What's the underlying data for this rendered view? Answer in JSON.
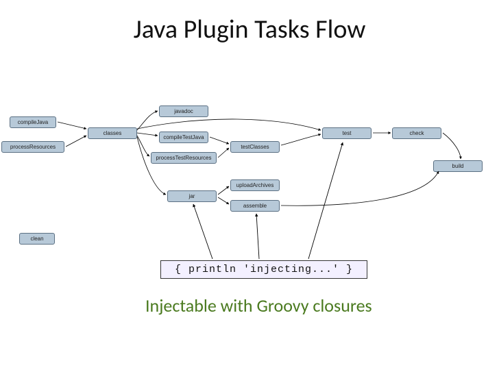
{
  "title": "Java Plugin Tasks Flow",
  "nodes": {
    "compileJava": "compileJava",
    "processResources": "processResources",
    "classes": "classes",
    "javadoc": "javadoc",
    "compileTestJava": "compileTestJava",
    "processTestResources": "processTestResources",
    "testClasses": "testClasses",
    "test": "test",
    "check": "check",
    "build": "build",
    "jar": "jar",
    "uploadArchives": "uploadArchives",
    "assemble": "assemble",
    "clean": "clean"
  },
  "code_snippet": "{ println 'injecting...' }",
  "subtitle": "Injectable with Groovy closures",
  "diagram_edges": [
    [
      "compileJava",
      "classes"
    ],
    [
      "processResources",
      "classes"
    ],
    [
      "classes",
      "javadoc"
    ],
    [
      "classes",
      "compileTestJava"
    ],
    [
      "classes",
      "processTestResources"
    ],
    [
      "classes",
      "jar"
    ],
    [
      "compileTestJava",
      "testClasses"
    ],
    [
      "processTestResources",
      "testClasses"
    ],
    [
      "testClasses",
      "test"
    ],
    [
      "classes",
      "test"
    ],
    [
      "test",
      "check"
    ],
    [
      "check",
      "build"
    ],
    [
      "jar",
      "uploadArchives"
    ],
    [
      "jar",
      "assemble"
    ],
    [
      "assemble",
      "build"
    ]
  ]
}
